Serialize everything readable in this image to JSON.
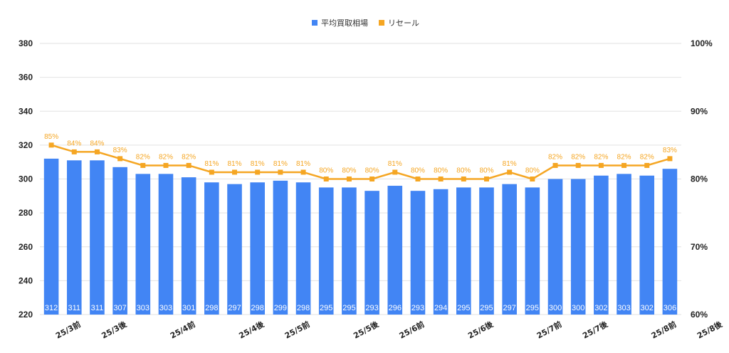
{
  "colors": {
    "bar": "#4285f4",
    "line": "#f5a623",
    "grid": "#e2e2e2"
  },
  "chart_data": {
    "type": "bar",
    "categories": [
      "",
      "25/3前",
      "",
      "25/3後",
      "",
      "",
      "25/4前",
      "",
      "",
      "25/4後",
      "",
      "25/5前",
      "",
      "",
      "25/5後",
      "",
      "25/6前",
      "",
      "",
      "25/6後",
      "",
      "",
      "25/7前",
      "",
      "25/7後",
      "",
      "",
      "25/8前",
      "",
      "25/8後"
    ],
    "series": [
      {
        "name": "平均買取相場",
        "type": "bar",
        "axis": "left",
        "values": [
          312,
          311,
          311,
          307,
          303,
          303,
          301,
          298,
          297,
          298,
          299,
          298,
          295,
          295,
          293,
          296,
          293,
          294,
          295,
          295,
          297,
          295,
          300,
          300,
          302,
          303,
          302,
          306
        ]
      },
      {
        "name": "リセール",
        "type": "line",
        "axis": "right",
        "values": [
          85,
          84,
          84,
          83,
          82,
          82,
          82,
          81,
          81,
          81,
          81,
          81,
          80,
          80,
          80,
          81,
          80,
          80,
          80,
          80,
          81,
          80,
          82,
          82,
          82,
          82,
          82,
          83
        ]
      }
    ],
    "y_left": {
      "ylim": [
        220,
        380
      ],
      "ticks": [
        "220",
        "240",
        "260",
        "280",
        "300",
        "320",
        "340",
        "360",
        "380"
      ]
    },
    "y_right": {
      "ylim": [
        60,
        100
      ],
      "ticks": [
        "60%",
        "70%",
        "80%",
        "90%",
        "100%"
      ]
    },
    "grid": true,
    "legend": "top-center"
  }
}
